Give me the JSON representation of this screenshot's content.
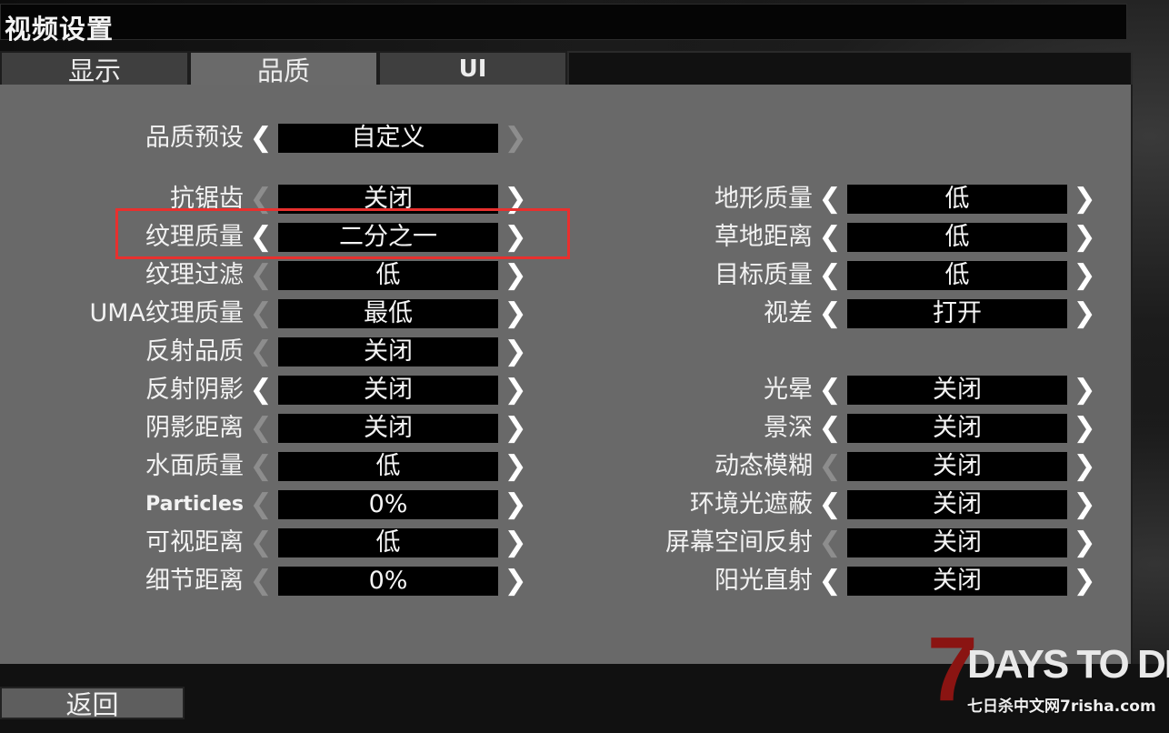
{
  "window": {
    "title": "视频设置"
  },
  "tabs": [
    {
      "label": "显示",
      "active": false
    },
    {
      "label": "品质",
      "active": true
    },
    {
      "label": "UI",
      "active": false
    }
  ],
  "preset": {
    "label": "品质预设",
    "value": "自定义"
  },
  "left_settings": [
    {
      "label": "抗锯齿",
      "value": "关闭"
    },
    {
      "label": "纹理质量",
      "value": "二分之一"
    },
    {
      "label": "纹理过滤",
      "value": "低"
    },
    {
      "label": "UMA纹理质量",
      "value": "最低"
    },
    {
      "label": "反射品质",
      "value": "关闭"
    },
    {
      "label": "反射阴影",
      "value": "关闭"
    },
    {
      "label": "阴影距离",
      "value": "关闭"
    },
    {
      "label": "水面质量",
      "value": "低"
    },
    {
      "label": "Particles",
      "value": "0%"
    },
    {
      "label": "可视距离",
      "value": "低"
    },
    {
      "label": "细节距离",
      "value": "0%"
    }
  ],
  "right_settings": [
    {
      "label": "地形质量",
      "value": "低"
    },
    {
      "label": "草地距离",
      "value": "低"
    },
    {
      "label": "目标质量",
      "value": "低"
    },
    {
      "label": "视差",
      "value": "打开"
    },
    {
      "label": "光晕",
      "value": "关闭"
    },
    {
      "label": "景深",
      "value": "关闭"
    },
    {
      "label": "动态模糊",
      "value": "关闭"
    },
    {
      "label": "环境光遮蔽",
      "value": "关闭"
    },
    {
      "label": "屏幕空间反射",
      "value": "关闭"
    },
    {
      "label": "阳光直射",
      "value": "关闭"
    }
  ],
  "footer": {
    "back_label": "返回"
  },
  "logo": {
    "seven": "7",
    "text": "DAYS TO DIE",
    "watermark": "七日杀中文网7risha.com"
  },
  "icons": {
    "prev": "chevron-left-icon",
    "next": "chevron-right-icon"
  },
  "colors": {
    "panel": "#696969",
    "highlight": "#e8302e",
    "value_box": "#000000"
  }
}
